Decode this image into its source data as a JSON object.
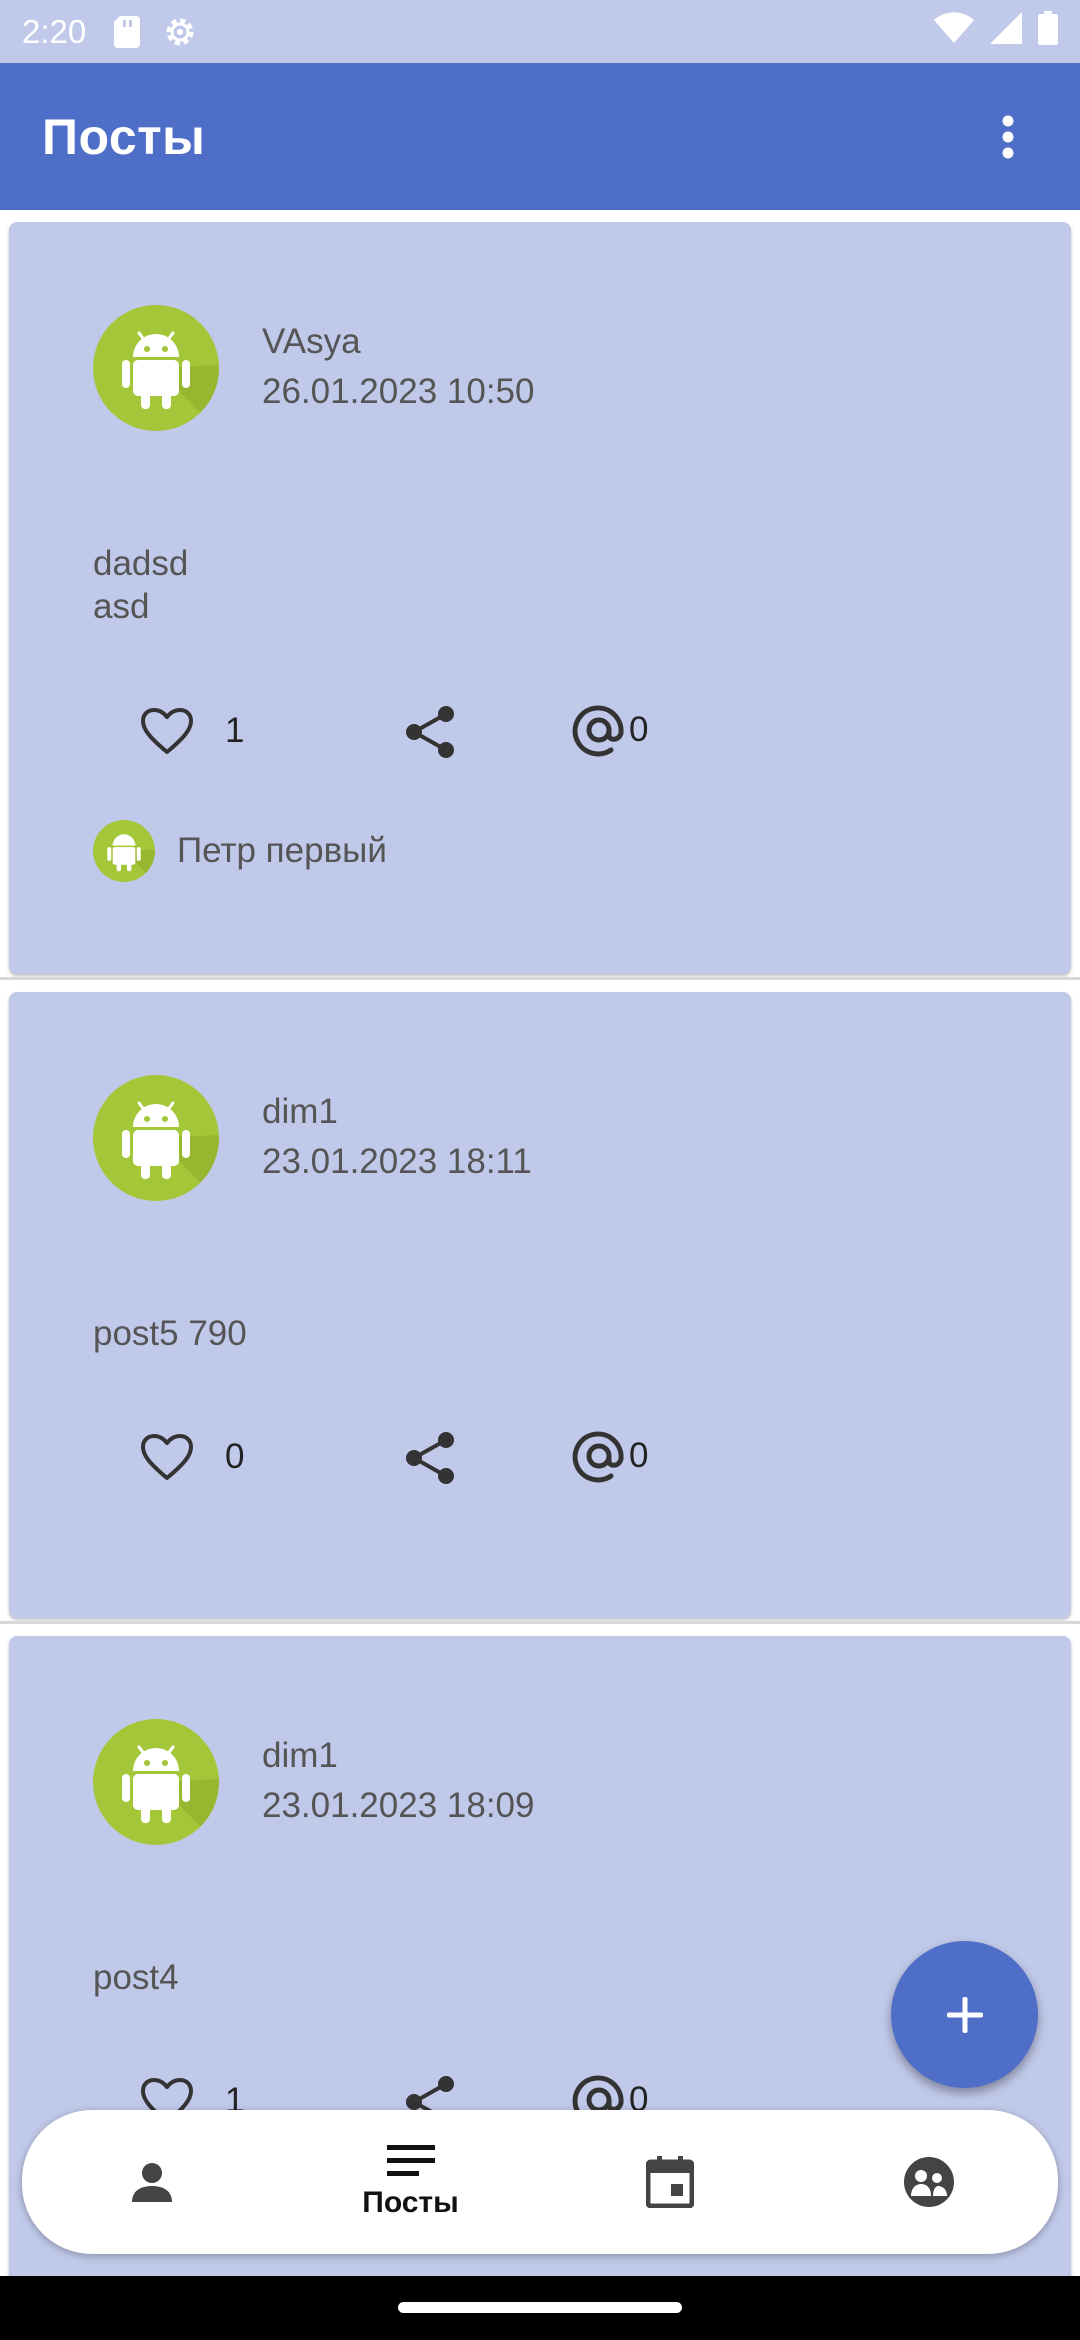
{
  "status_bar": {
    "time": "2:20",
    "left_icons": [
      "sd-card-icon",
      "settings-gear-icon"
    ],
    "right_icons": [
      "wifi-icon",
      "signal-icon",
      "battery-icon"
    ]
  },
  "app_bar": {
    "title": "Посты",
    "menu_icon": "more-vert-icon"
  },
  "posts": [
    {
      "author": "VAsya",
      "date": "26.01.2023 10:50",
      "text_lines": [
        "dadsd",
        "asd"
      ],
      "likes": "1",
      "mentions": "0",
      "liker_name": "Петр первый"
    },
    {
      "author": "dim1",
      "date": "23.01.2023 18:11",
      "text_lines": [
        "post5 790"
      ],
      "likes": "0",
      "mentions": "0"
    },
    {
      "author": "dim1",
      "date": "23.01.2023 18:09",
      "text_lines": [
        "post4"
      ],
      "likes": "1",
      "mentions": "0"
    }
  ],
  "fab": {
    "icon": "add-icon"
  },
  "bottom_nav": {
    "items": [
      {
        "icon": "person-icon",
        "label": ""
      },
      {
        "icon": "posts-list-icon",
        "label": "Посты",
        "active": true
      },
      {
        "icon": "calendar-icon",
        "label": ""
      },
      {
        "icon": "people-icon",
        "label": ""
      }
    ]
  },
  "colors": {
    "primary": "#4F6EC7",
    "card_background": "#C1C9EA",
    "avatar_green": "#A4C639"
  }
}
